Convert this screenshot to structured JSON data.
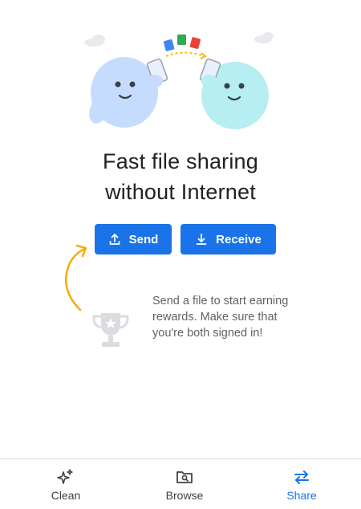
{
  "hero": {
    "headline_line1": "Fast file sharing",
    "headline_line2": "without Internet"
  },
  "actions": {
    "send_label": "Send",
    "receive_label": "Receive"
  },
  "rewards": {
    "message": "Send a file to start earning rewards. Make sure that you're both signed in!"
  },
  "bottom_nav": {
    "items": [
      {
        "label": "Clean",
        "icon": "sparkle-icon",
        "active": false
      },
      {
        "label": "Browse",
        "icon": "folder-search-icon",
        "active": false
      },
      {
        "label": "Share",
        "icon": "swap-arrows-icon",
        "active": true
      }
    ]
  },
  "colors": {
    "accent": "#1a73e8",
    "arrow": "#f9ab00",
    "left_character": "#c6dcff",
    "right_character": "#b6eef2",
    "trophy": "#dadce0"
  }
}
